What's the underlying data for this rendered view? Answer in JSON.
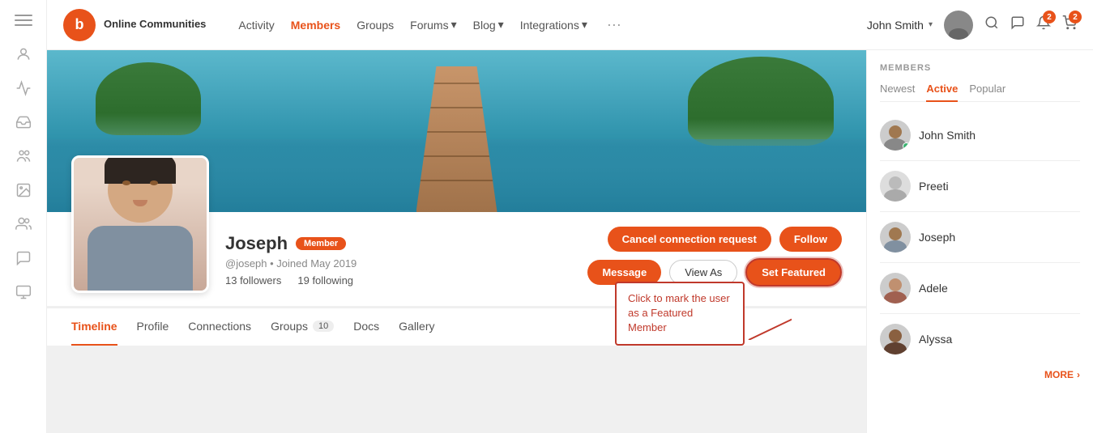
{
  "logo": {
    "symbol": "b",
    "name": "Online Communities"
  },
  "nav": {
    "items": [
      {
        "label": "Activity",
        "active": false
      },
      {
        "label": "Members",
        "active": true
      },
      {
        "label": "Groups",
        "active": false
      },
      {
        "label": "Forums",
        "active": false,
        "hasArrow": true
      },
      {
        "label": "Blog",
        "active": false,
        "hasArrow": true
      },
      {
        "label": "Integrations",
        "active": false,
        "hasArrow": true
      }
    ],
    "more_label": "···",
    "user_name": "John Smith",
    "chevron": "▾"
  },
  "profile": {
    "name": "Joseph",
    "member_badge": "Member",
    "handle": "@joseph • Joined May 2019",
    "followers": "13 followers",
    "following": "19 following",
    "actions": {
      "cancel_connection": "Cancel connection request",
      "follow": "Follow",
      "message": "Message",
      "view_as": "View As",
      "set_featured": "Set Featured"
    },
    "tooltip": "Click to mark the user as a Featured Member"
  },
  "tabs": [
    {
      "label": "Timeline",
      "active": true
    },
    {
      "label": "Profile",
      "active": false
    },
    {
      "label": "Connections",
      "active": false
    },
    {
      "label": "Groups",
      "active": false,
      "badge": "10"
    },
    {
      "label": "Docs",
      "active": false
    },
    {
      "label": "Gallery",
      "active": false
    }
  ],
  "right_sidebar": {
    "header": "MEMBERS",
    "tabs": [
      {
        "label": "Newest",
        "active": false
      },
      {
        "label": "Active",
        "active": true
      },
      {
        "label": "Popular",
        "active": false
      }
    ],
    "members": [
      {
        "name": "John Smith",
        "online": true
      },
      {
        "name": "Preeti",
        "online": false
      },
      {
        "name": "Joseph",
        "online": false
      },
      {
        "name": "Adele",
        "online": false
      },
      {
        "name": "Alyssa",
        "online": false
      }
    ],
    "more_label": "MORE",
    "more_arrow": "›"
  }
}
